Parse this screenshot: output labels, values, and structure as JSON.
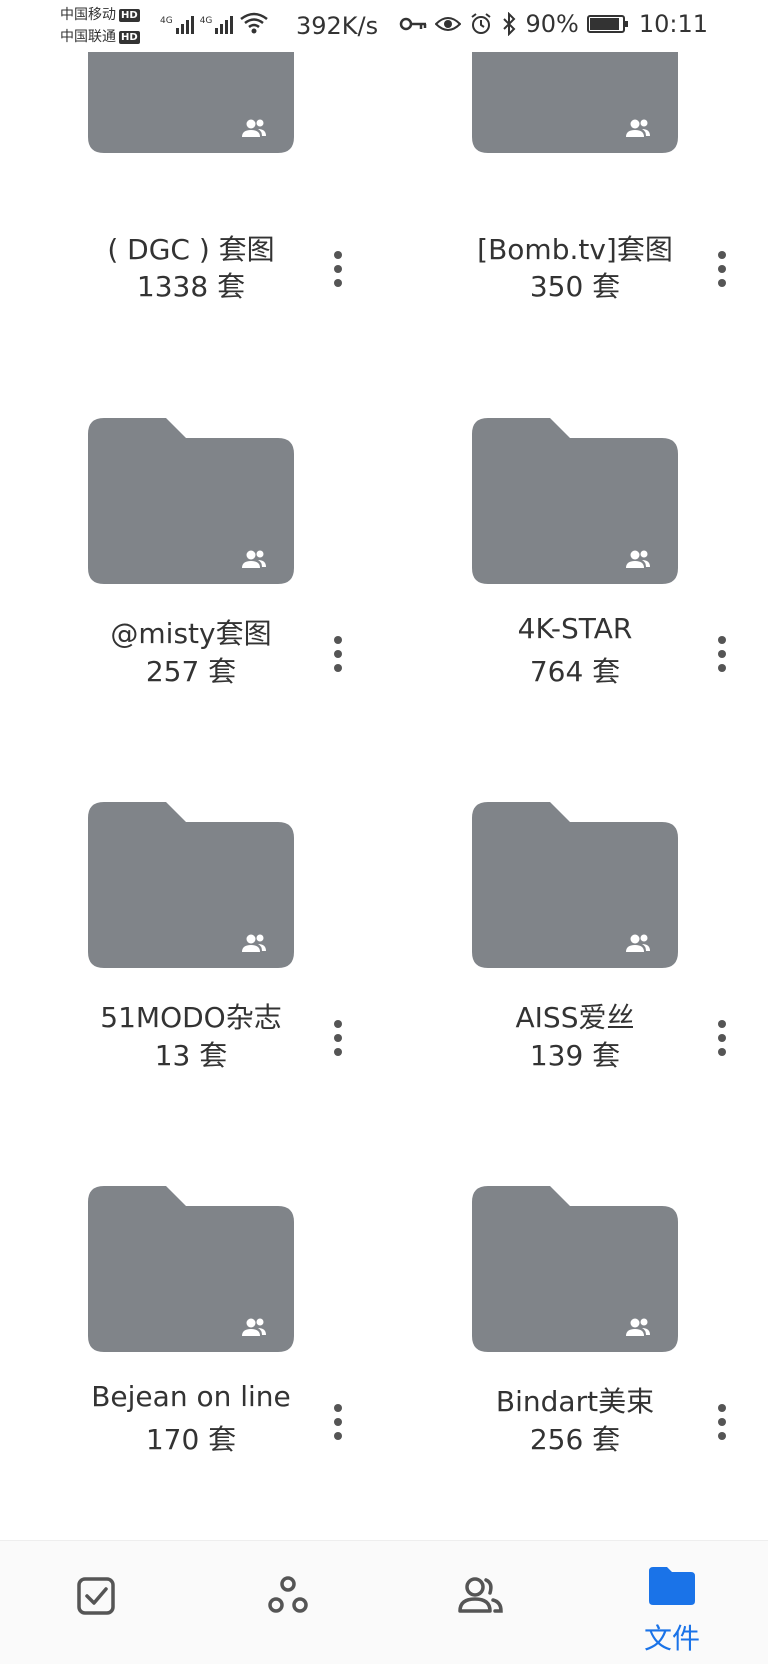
{
  "status_bar": {
    "carrier_1": "中国移动",
    "carrier_2": "中国联通",
    "hd_badge": "HD",
    "signal_tag": "4G",
    "net_speed": "392K/s",
    "battery_percent": "90%",
    "battery_level": 0.9,
    "time": "10:11"
  },
  "folders": [
    {
      "name": "( DGC ) 套图",
      "count": "1338 套"
    },
    {
      "name": "[Bomb.tv]套图",
      "count": "350 套"
    },
    {
      "name": "@misty套图",
      "count": "257 套"
    },
    {
      "name": "4K-STAR",
      "count": "764 套"
    },
    {
      "name": "51MODO杂志",
      "count": "13 套"
    },
    {
      "name": "AISS爱丝",
      "count": "139 套"
    },
    {
      "name": "Bejean on line",
      "count": "170 套"
    },
    {
      "name": "Bindart美束",
      "count": "256 套"
    }
  ],
  "bottom_nav": {
    "items": [
      {
        "icon": "checkbox-icon",
        "label": ""
      },
      {
        "icon": "share-nodes-icon",
        "label": ""
      },
      {
        "icon": "people-icon",
        "label": ""
      },
      {
        "icon": "folder-icon",
        "label": "文件",
        "active": true
      }
    ]
  },
  "colors": {
    "folder": "#808489",
    "accent": "#1a73e8",
    "text": "#333333"
  }
}
